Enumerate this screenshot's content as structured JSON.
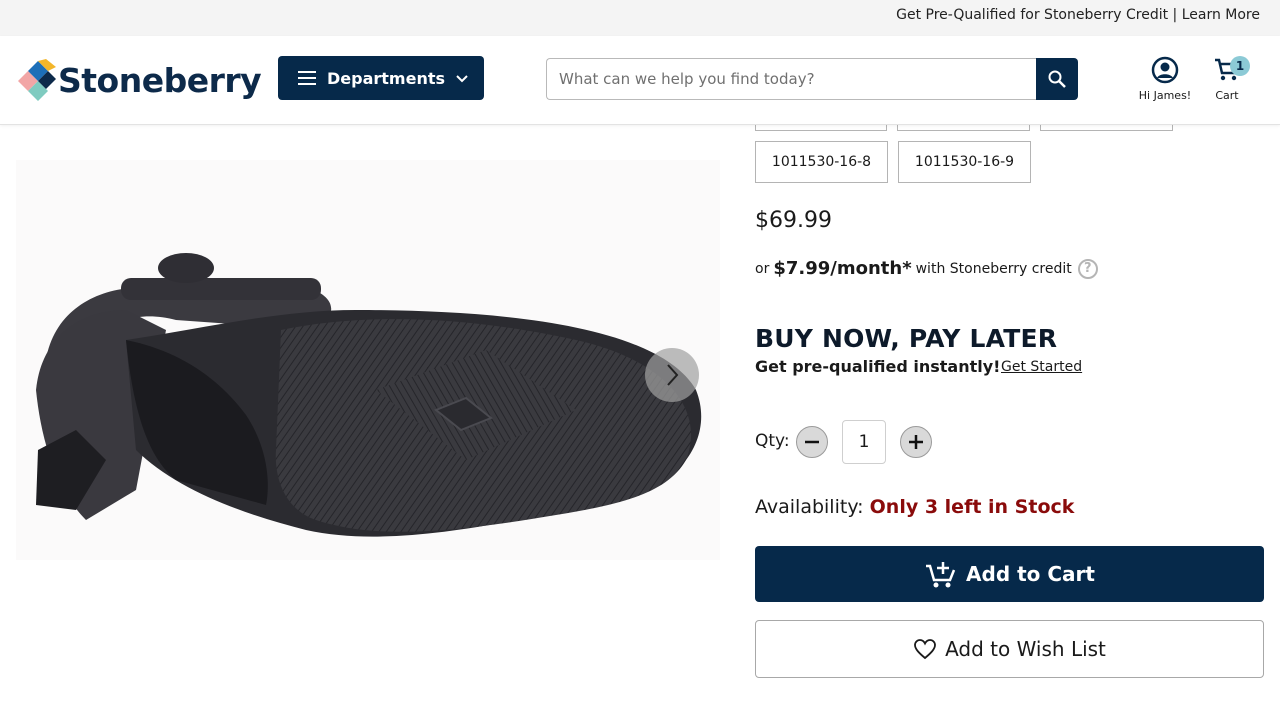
{
  "promo_bar": {
    "text": "Get Pre-Qualified for Stoneberry Credit | Learn More"
  },
  "header": {
    "logo_text": "Stoneberry",
    "departments_label": "Departments",
    "search_placeholder": "What can we help you find today?",
    "account_label": "Hi James!",
    "cart_label": "Cart",
    "cart_count": "1"
  },
  "colors": {
    "navy": "#06294a",
    "stock_red": "#8a0b0b",
    "badge": "#8ccad6"
  },
  "product": {
    "sku_options": [
      "1011530-16-8",
      "1011530-16-9"
    ],
    "price": "$69.99",
    "credit": {
      "prefix": "or",
      "monthly": "$7.99/month*",
      "suffix": "with Stoneberry credit"
    },
    "bnpl": {
      "title": "BUY NOW, PAY LATER",
      "subtitle": "Get pre-qualified instantly!",
      "link": "Get Started"
    },
    "quantity": {
      "label": "Qty:",
      "value": "1"
    },
    "availability": {
      "label": "Availability:",
      "status": "Only 3 left in Stock"
    },
    "add_to_cart_label": "Add to Cart",
    "wishlist_label": "Add to Wish List"
  },
  "icons": [
    "menu-icon",
    "chevron-down-icon",
    "search-icon",
    "user-circle-icon",
    "cart-icon",
    "chevron-right-icon",
    "help-icon",
    "minus-icon",
    "plus-icon",
    "add-cart-icon",
    "heart-icon"
  ]
}
